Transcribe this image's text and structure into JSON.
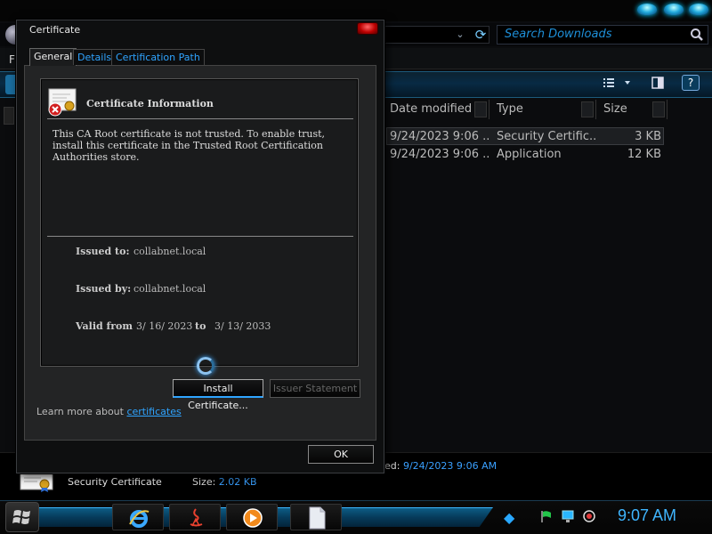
{
  "explorer": {
    "search_placeholder": "Search Downloads",
    "menu_first_letter": "F",
    "columns": [
      {
        "label": "Date modified"
      },
      {
        "label": "Type"
      },
      {
        "label": "Size"
      }
    ],
    "files": [
      {
        "date": "9/24/2023 9:06 ...",
        "type": "Security Certific...",
        "size": "3 KB"
      },
      {
        "date": "9/24/2023 9:06 ...",
        "type": "Application",
        "size": "12 KB"
      }
    ],
    "details_pane": {
      "modified_label": "ed:",
      "modified_value": "9/24/2023 9:06 AM",
      "file_name": "Security Certificate",
      "size_label": "Size:",
      "size_value": "2.02 KB"
    }
  },
  "dialog": {
    "title": "Certificate",
    "tabs": [
      {
        "label": "General"
      },
      {
        "label": "Details"
      },
      {
        "label": "Certification Path"
      }
    ],
    "heading": "Certificate Information",
    "warning": "This CA Root certificate is not trusted. To enable trust, install this certificate in the Trusted Root Certification Authorities store.",
    "issued_to_label": "Issued to:",
    "issued_to": "collabnet.local",
    "issued_by_label": "Issued by:",
    "issued_by": "collabnet.local",
    "valid_from_label": "Valid from",
    "valid_from": "3/ 16/ 2023",
    "valid_to_label": "to",
    "valid_to": "3/ 13/ 2033",
    "install_button": "Install Certificate...",
    "issuer_button": "Issuer Statement",
    "learn_more_prefix": "Learn more about ",
    "learn_more_link": "certificates",
    "ok_button": "OK"
  },
  "taskbar": {
    "clock": "9:07 AM",
    "apps": [
      "internet-explorer",
      "java",
      "media-player",
      "document"
    ]
  },
  "colors": {
    "accent": "#2fa4ff",
    "clock": "#3fb6ff",
    "close": "#c00000"
  }
}
